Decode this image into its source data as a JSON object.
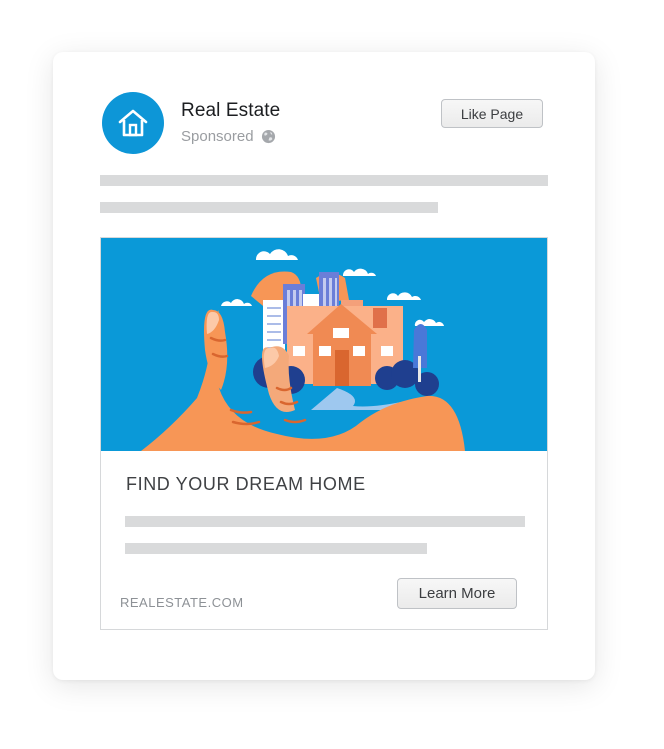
{
  "post": {
    "page_name": "Real Estate",
    "sponsored_label": "Sponsored",
    "like_button_label": "Like Page"
  },
  "ad": {
    "headline": "FIND YOUR DREAM HOME",
    "domain": "REALESTATE.COM",
    "cta_label": "Learn More"
  },
  "icons": {
    "avatar": "house-icon",
    "audience": "globe-icon"
  },
  "colors": {
    "brand_blue": "#0d96d7",
    "hero_background": "#0a99d8",
    "hand": "#f79656",
    "house": "#f08a53",
    "placeholder_bar": "#d9dadb"
  }
}
